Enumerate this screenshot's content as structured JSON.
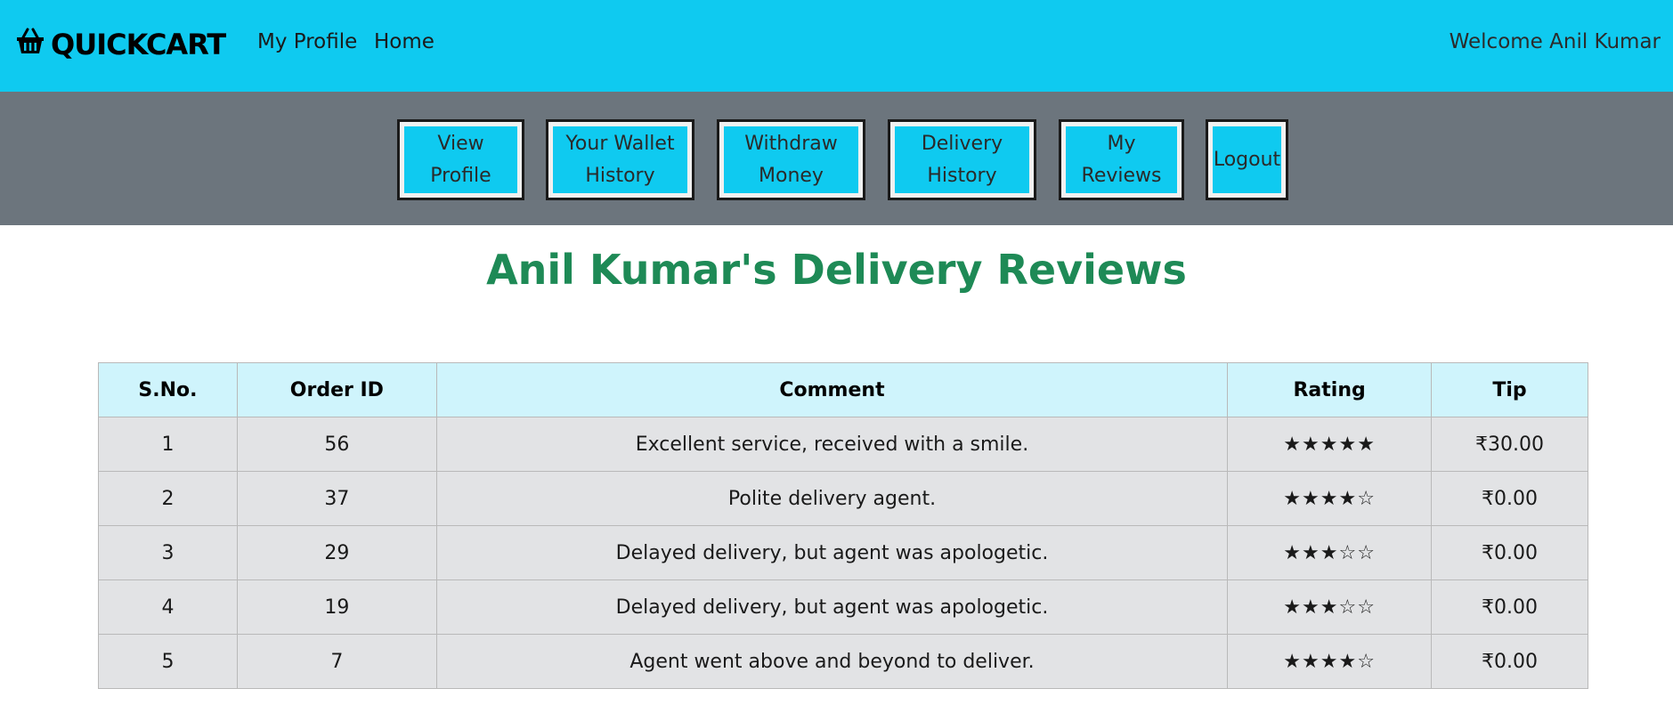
{
  "navbar": {
    "brand": "QUICKCART",
    "links": [
      "My Profile",
      "Home"
    ],
    "welcome": "Welcome Anil Kumar"
  },
  "sidebar_buttons": [
    {
      "label": "View Profile"
    },
    {
      "label": "Your Wallet\nHistory"
    },
    {
      "label": "Withdraw\nMoney"
    },
    {
      "label": "Delivery\nHistory"
    },
    {
      "label": "My Reviews"
    },
    {
      "label": "Logout"
    }
  ],
  "page_title": "Anil Kumar's Delivery Reviews",
  "table": {
    "headers": [
      "S.No.",
      "Order ID",
      "Comment",
      "Rating",
      "Tip"
    ],
    "rows": [
      {
        "sno": "1",
        "order_id": "56",
        "comment": "Excellent service, received with a smile.",
        "rating": "★★★★★",
        "tip": "₹30.00"
      },
      {
        "sno": "2",
        "order_id": "37",
        "comment": "Polite delivery agent.",
        "rating": "★★★★☆",
        "tip": "₹0.00"
      },
      {
        "sno": "3",
        "order_id": "29",
        "comment": "Delayed delivery, but agent was apologetic.",
        "rating": "★★★☆☆",
        "tip": "₹0.00"
      },
      {
        "sno": "4",
        "order_id": "19",
        "comment": "Delayed delivery, but agent was apologetic.",
        "rating": "★★★☆☆",
        "tip": "₹0.00"
      },
      {
        "sno": "5",
        "order_id": "7",
        "comment": "Agent went above and beyond to deliver.",
        "rating": "★★★★☆",
        "tip": "₹0.00"
      }
    ]
  },
  "colors": {
    "navbar": "#0fcaf0",
    "button_bar": "#6c757d",
    "title": "#1e8a56",
    "table_header": "#cff4fc",
    "table_row": "#e2e3e5"
  }
}
